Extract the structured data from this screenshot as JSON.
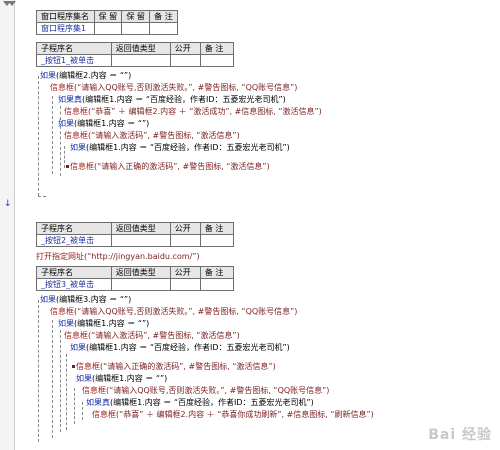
{
  "top_table": {
    "headers": [
      "窗口程序集名",
      "保 留",
      "保 留",
      "备 注"
    ],
    "row": [
      "窗口程序集1",
      "",
      "",
      ""
    ]
  },
  "sub_headers": [
    "子程序名",
    "返回值类型",
    "公开",
    "备 注"
  ],
  "sub1": {
    "name": "_按钮1_被单击",
    "lines": [
      {
        "kw": "如果",
        "rest": "(编辑框2.内容 ＝ “”)"
      },
      {
        "fn": "信息框",
        "rest": "(“请输入QQ账号,否则激活失败。”, #警告图标, “QQ账号信息”)"
      },
      {
        "kw": "如果真",
        "rest": "(编辑框1.内容 ＝ “百度经验，作者ID：五菱宏光老司机”)"
      },
      {
        "fn": "信息框",
        "rest": "(“恭喜” ＋ 编辑框2.内容 ＋ “激活成功”, #信息图标, “激活信息”)"
      },
      {
        "kw": "如果",
        "rest": "(编辑框1.内容 ＝ “”)"
      },
      {
        "fn": "信息框",
        "rest": "(“请输入激活码”, #警告图标, “激活信息”)"
      },
      {
        "kw": "如果",
        "rest": "(编辑框1.内容 ＝ “百度经验，作者ID：五菱宏光老司机”)"
      },
      {
        "fn": "信息框",
        "rest": "(“请输入正确的激活码”, #警告图标, “激活信息”)"
      }
    ]
  },
  "sub2": {
    "name": "_按钮2_被单击",
    "line": {
      "fn": "打开指定网址",
      "rest": "(“http://jingyan.baidu.com/”)"
    }
  },
  "sub3": {
    "name": "_按钮3_被单击",
    "lines": [
      {
        "kw": "如果",
        "rest": "(编辑框3.内容 ＝ “”)"
      },
      {
        "fn": "信息框",
        "rest": "(“请输入QQ账号,否则激活失败。”, #警告图标, “QQ账号信息”)"
      },
      {
        "kw": "如果",
        "rest": "(编辑框1.内容 ＝ “”)"
      },
      {
        "fn": "信息框",
        "rest": "(“请输入激活码”, #警告图标, “激活信息”)"
      },
      {
        "kw": "如果",
        "rest": "(编辑框1.内容 ＝ “百度经验，作者ID：五菱宏光老司机”)"
      },
      {
        "fn": "信息框",
        "rest": "(“请输入正确的激活码”, #警告图标, “激活信息”)"
      },
      {
        "kw": "如果",
        "rest": "(编辑框1.内容 ＝ “”)"
      },
      {
        "fn": "信息框",
        "rest": "(“请输入QQ账号,否则激活失败。”, #警告图标, “QQ账号信息”)"
      },
      {
        "kw": "如果真",
        "rest": "(编辑框1.内容 ＝ “百度经验，作者ID：五菱宏光老司机”)"
      },
      {
        "fn": "信息框",
        "rest": "(“恭喜” ＋ 编辑框2.内容 ＋ “恭喜你成功刷新”, #信息图标, “刷新信息”)"
      }
    ]
  },
  "watermark": "Bai 经验"
}
